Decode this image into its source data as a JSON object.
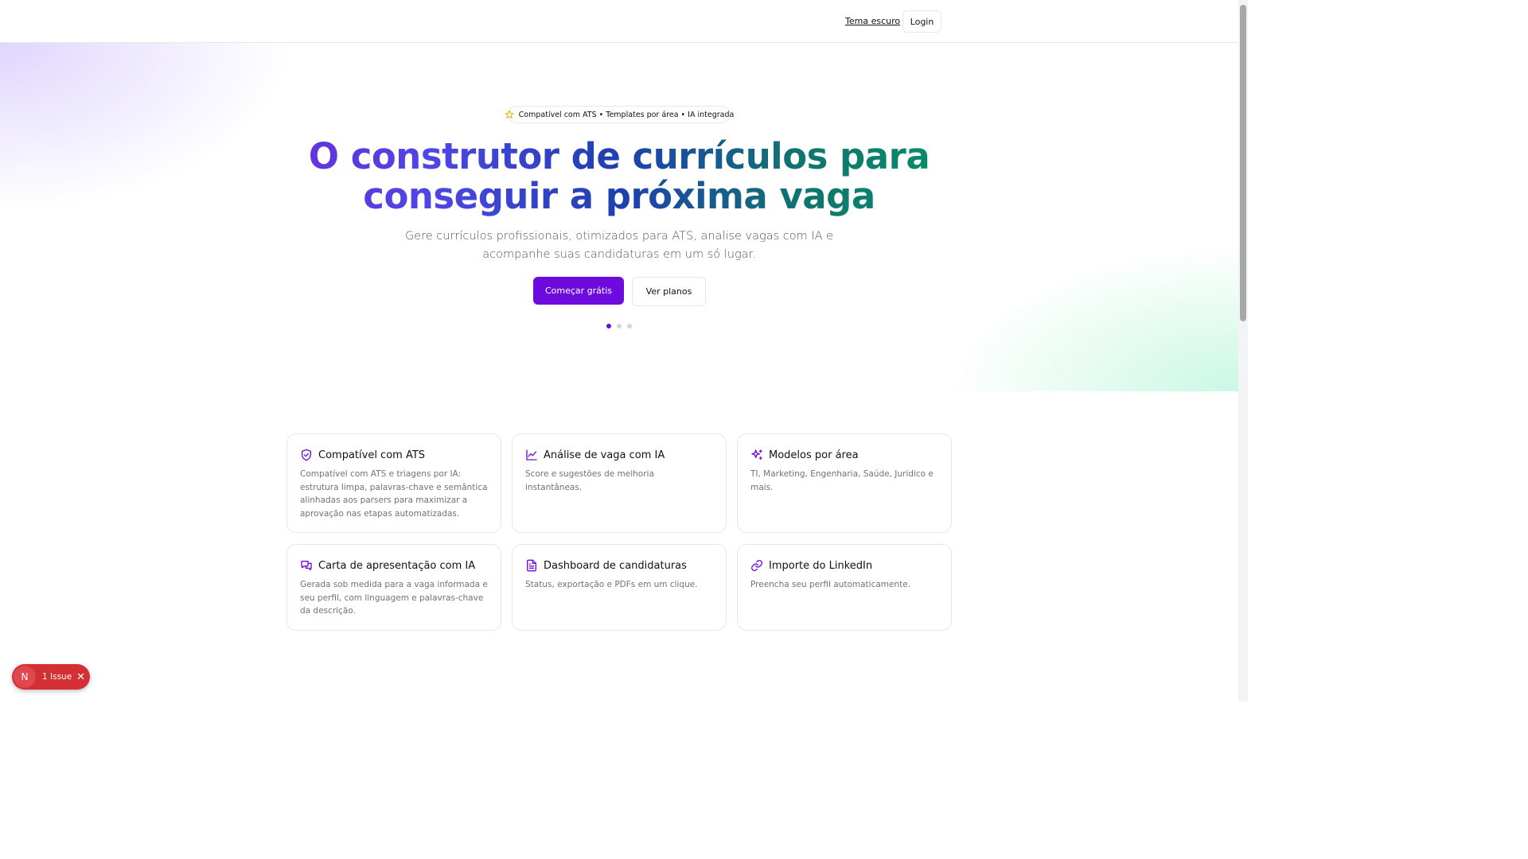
{
  "header": {
    "theme_link": "Tema escuro",
    "login_label": "Login"
  },
  "hero": {
    "pill_text": "Compatível com ATS • Templates por área • IA integrada",
    "headline_line1": "O construtor de currículos para",
    "headline_line2": "conseguir a próxima vaga",
    "subtitle": "Gere currículos profissionais, otimizados para ATS, analise vagas com IA e acompanhe suas candidaturas em um só lugar.",
    "primary_cta": "Começar grátis",
    "secondary_cta": "Ver planos",
    "carousel": {
      "slides": 3,
      "active": 1
    }
  },
  "features": [
    {
      "icon": "shield-check-icon",
      "title": "Compatível com ATS",
      "desc": "Compatível com ATS e triagens por IA: estrutura limpa, palavras-chave e semântica alinhadas aos parsers para maximizar a aprovação nas etapas automatizadas."
    },
    {
      "icon": "line-chart-icon",
      "title": "Análise de vaga com IA",
      "desc": "Score e sugestões de melhoria instantâneas."
    },
    {
      "icon": "sparkles-icon",
      "title": "Modelos por área",
      "desc": "TI, Marketing, Engenharia, Saúde, Jurídico e mais."
    },
    {
      "icon": "messages-icon",
      "title": "Carta de apresentação com IA",
      "desc": "Gerada sob medida para a vaga informada e seu perfil, com linguagem e palavras-chave da descrição."
    },
    {
      "icon": "file-text-icon",
      "title": "Dashboard de candidaturas",
      "desc": "Status, exportação e PDFs em um clique."
    },
    {
      "icon": "link-icon",
      "title": "Importe do LinkedIn",
      "desc": "Preencha seu perfil automaticamente."
    }
  ],
  "dev_overlay": {
    "badge_letter": "N",
    "issues_label": "1 Issue",
    "close_glyph": "✕"
  },
  "colors": {
    "primary": "#6d0bdf",
    "gradient_start": "#6d28d9",
    "gradient_end": "#059669",
    "issue_badge": "#d32f35"
  }
}
